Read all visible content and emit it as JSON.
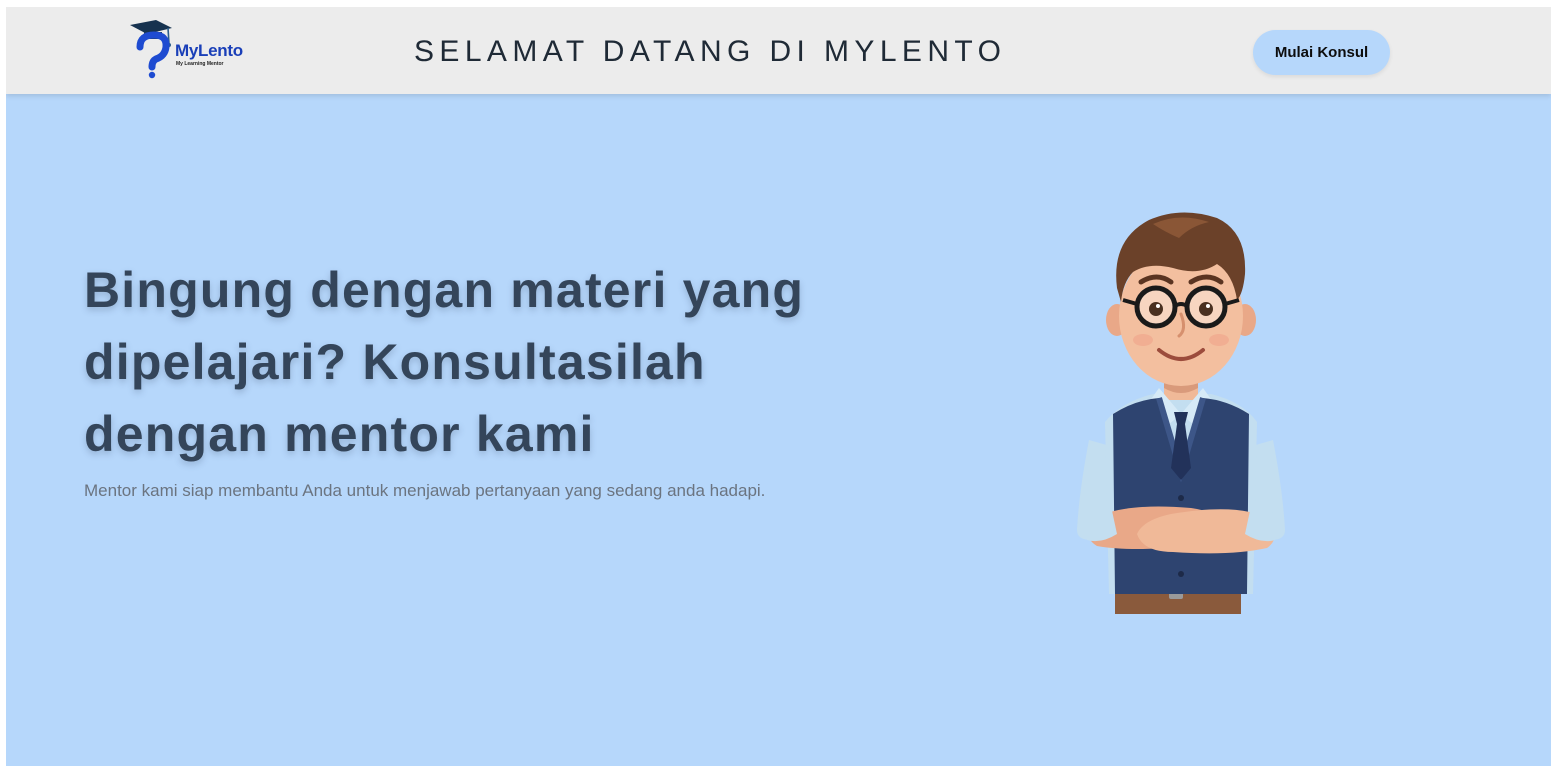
{
  "brand": {
    "name": "MyLento",
    "tagline": "My Learning Mentor",
    "icon": "graduation-cap-question-icon"
  },
  "header": {
    "title": "SELAMAT DATANG DI MYLENTO",
    "cta_label": "Mulai Konsul"
  },
  "hero": {
    "headline": "Bingung dengan materi yang dipelajari? Konsultasilah dengan mentor kami",
    "subtext": "Mentor kami siap membantu Anda untuk menjawab pertanyaan yang sedang anda hadapi.",
    "illustration": "cartoon-mentor-illustration"
  },
  "colors": {
    "hero_background": "#b6d7fb",
    "navbar_background": "#ececec",
    "button_background": "#b6d7fb",
    "headline": "#34455a",
    "brand_blue": "#1a3fb8"
  }
}
